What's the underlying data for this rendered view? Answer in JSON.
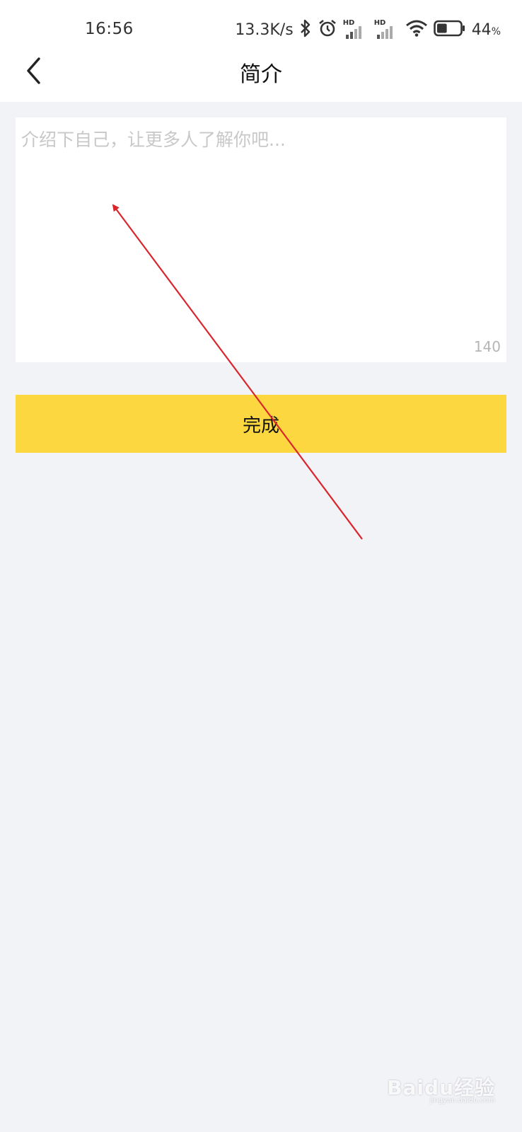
{
  "status_bar": {
    "time": "16:56",
    "net_speed": "13.3K/s",
    "battery_pct": "44",
    "battery_unit": "%",
    "battery_level": 0.44,
    "icons": [
      "bluetooth-icon",
      "alarm-icon",
      "signal-hd-icon",
      "signal-hd-icon",
      "wifi-icon",
      "battery-icon"
    ],
    "hd_label": "HD"
  },
  "nav": {
    "back_icon": "chevron-left-icon",
    "title": "简介"
  },
  "intro": {
    "placeholder": "介绍下自己，让更多人了解你吧...",
    "value": "",
    "counter": "140"
  },
  "actions": {
    "done_label": "完成"
  },
  "colors": {
    "background": "#f2f3f7",
    "accent_button": "#fcd740",
    "annotation_arrow": "#d9262c"
  },
  "watermark": {
    "brand": "Baidu经验",
    "url": "jingyan.baidu.com"
  }
}
